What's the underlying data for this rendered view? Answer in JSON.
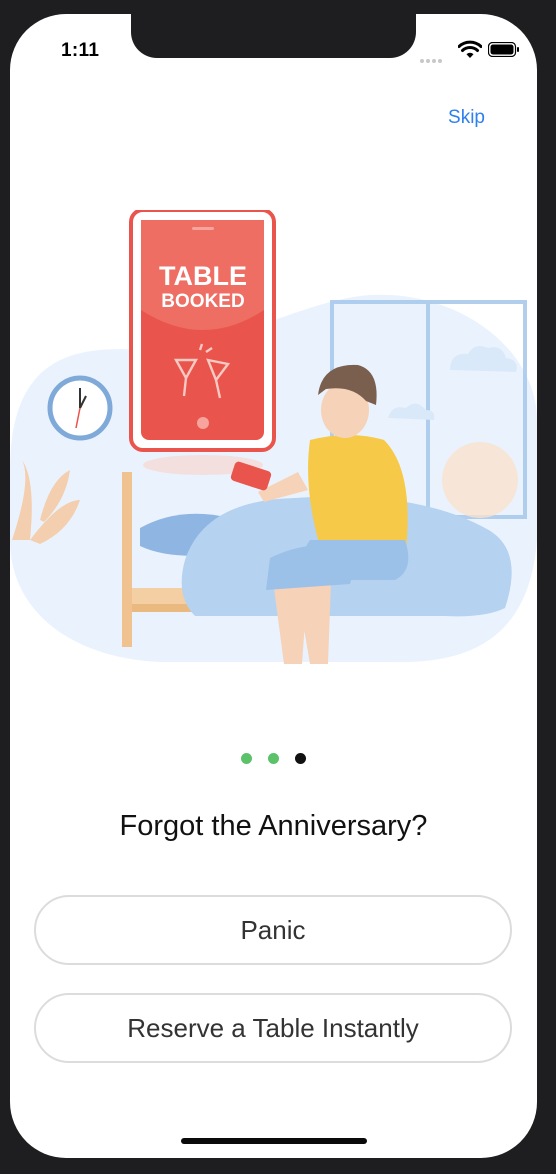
{
  "status_bar": {
    "time": "1:11",
    "icons": [
      "cellular-signal-icon",
      "wifi-icon",
      "battery-icon"
    ]
  },
  "header": {
    "skip_label": "Skip"
  },
  "illustration": {
    "phone_line1": "TABLE",
    "phone_line2": "BOOKED",
    "colors": {
      "phone_red": "#e9554d",
      "shirt_yellow": "#f7c948",
      "blanket_blue": "#b5d2f0",
      "background_blue": "#eaf3fd"
    }
  },
  "pager": {
    "total": 3,
    "active_index": 2,
    "colors": {
      "done": "#5cc26a",
      "active": "#111111"
    }
  },
  "main": {
    "headline": "Forgot the Anniversary?",
    "buttons": [
      {
        "label": "Panic"
      },
      {
        "label": "Reserve a Table Instantly"
      }
    ]
  },
  "colors": {
    "accent_link": "#2f80ed",
    "button_border": "#dcdcdc"
  }
}
